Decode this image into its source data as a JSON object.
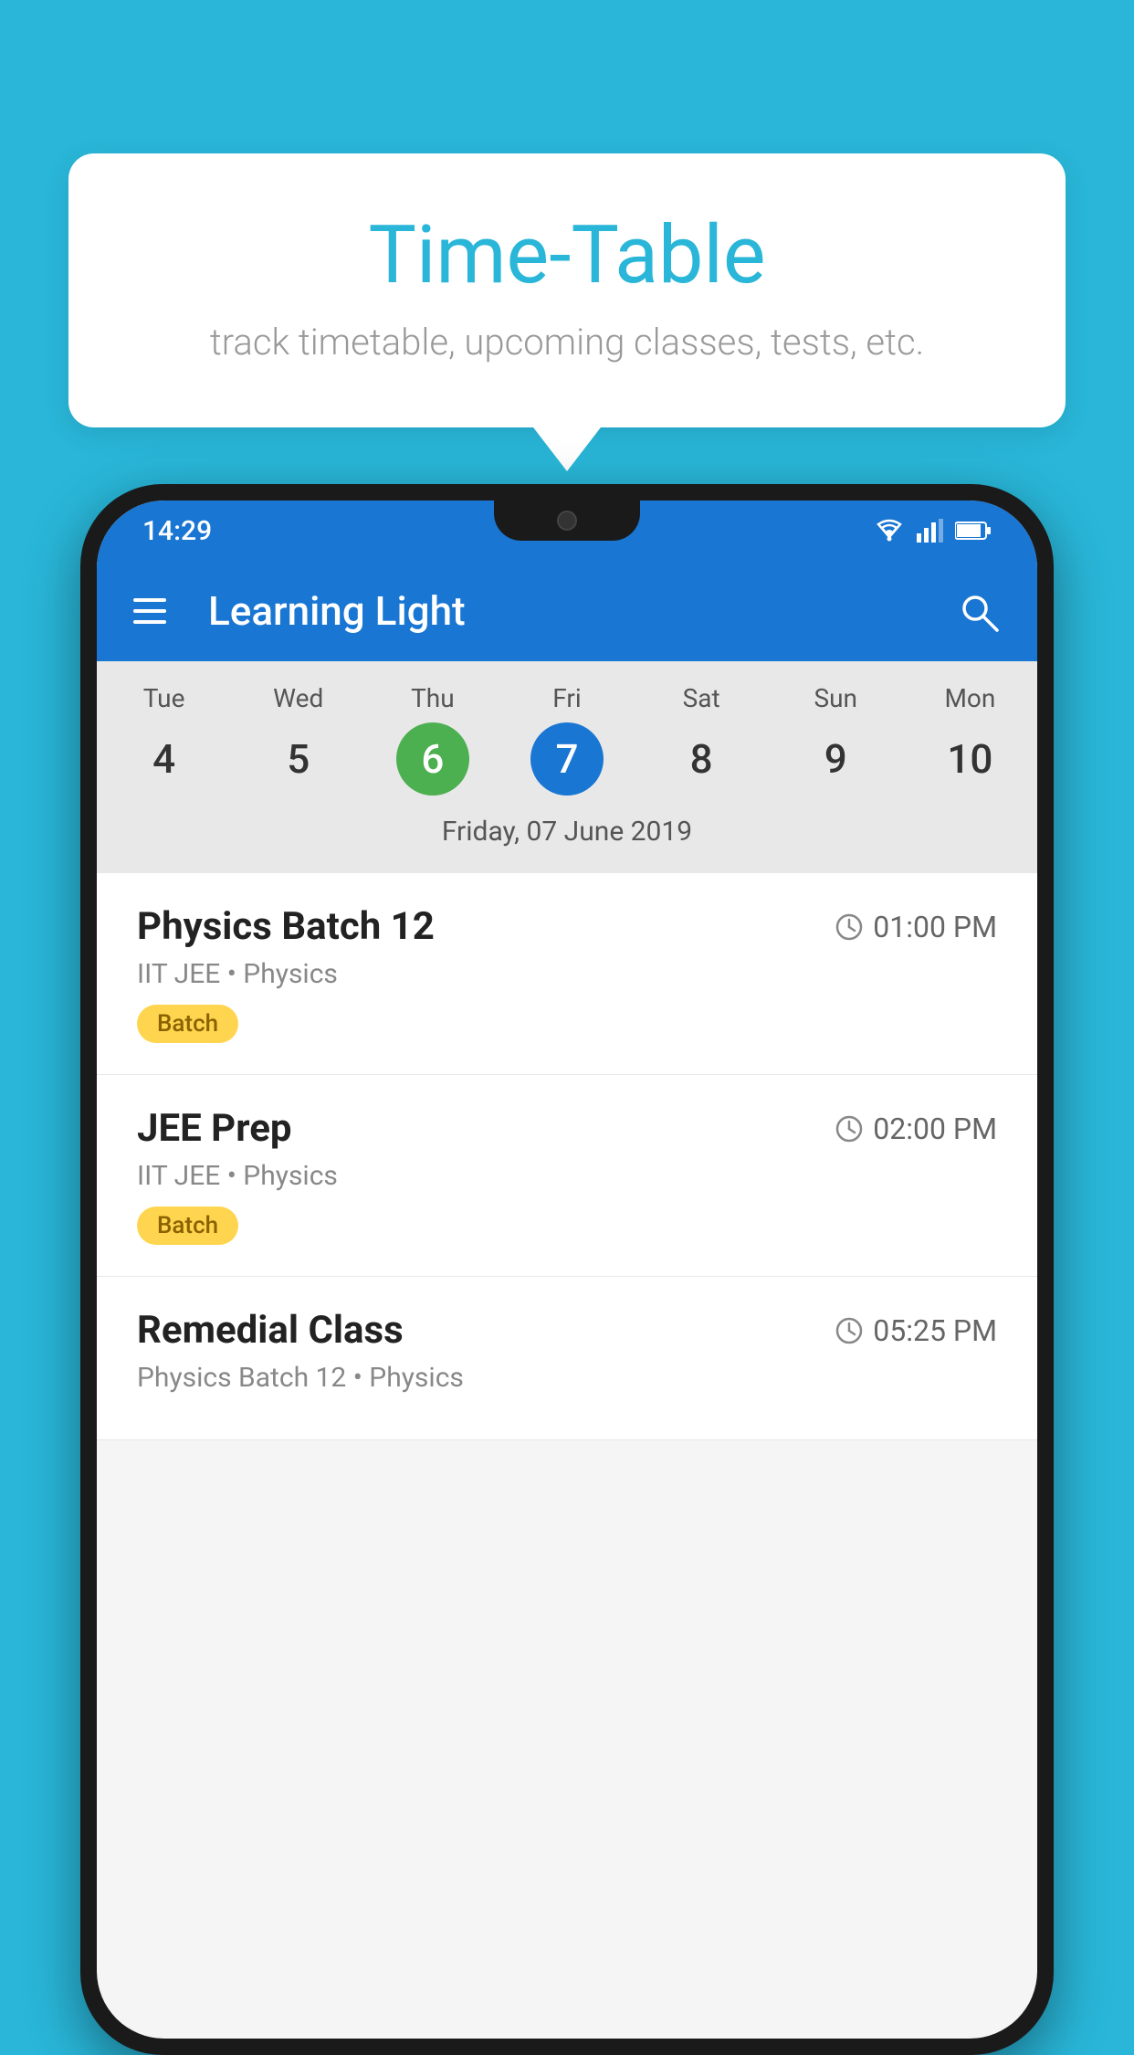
{
  "background_color": "#29b6d8",
  "tooltip": {
    "title": "Time-Table",
    "subtitle": "track timetable, upcoming classes, tests, etc."
  },
  "phone": {
    "status_bar": {
      "time": "14:29",
      "icons": [
        "wifi",
        "signal",
        "battery"
      ]
    },
    "app_bar": {
      "title": "Learning Light"
    },
    "calendar": {
      "days": [
        {
          "name": "Tue",
          "number": "4",
          "state": "normal"
        },
        {
          "name": "Wed",
          "number": "5",
          "state": "normal"
        },
        {
          "name": "Thu",
          "number": "6",
          "state": "today"
        },
        {
          "name": "Fri",
          "number": "7",
          "state": "selected"
        },
        {
          "name": "Sat",
          "number": "8",
          "state": "normal"
        },
        {
          "name": "Sun",
          "number": "9",
          "state": "normal"
        },
        {
          "name": "Mon",
          "number": "10",
          "state": "normal"
        }
      ],
      "selected_date_label": "Friday, 07 June 2019"
    },
    "classes": [
      {
        "name": "Physics Batch 12",
        "time": "01:00 PM",
        "info": "IIT JEE • Physics",
        "tag": "Batch"
      },
      {
        "name": "JEE Prep",
        "time": "02:00 PM",
        "info": "IIT JEE • Physics",
        "tag": "Batch"
      },
      {
        "name": "Remedial Class",
        "time": "05:25 PM",
        "info": "Physics Batch 12 • Physics",
        "tag": null
      }
    ]
  }
}
